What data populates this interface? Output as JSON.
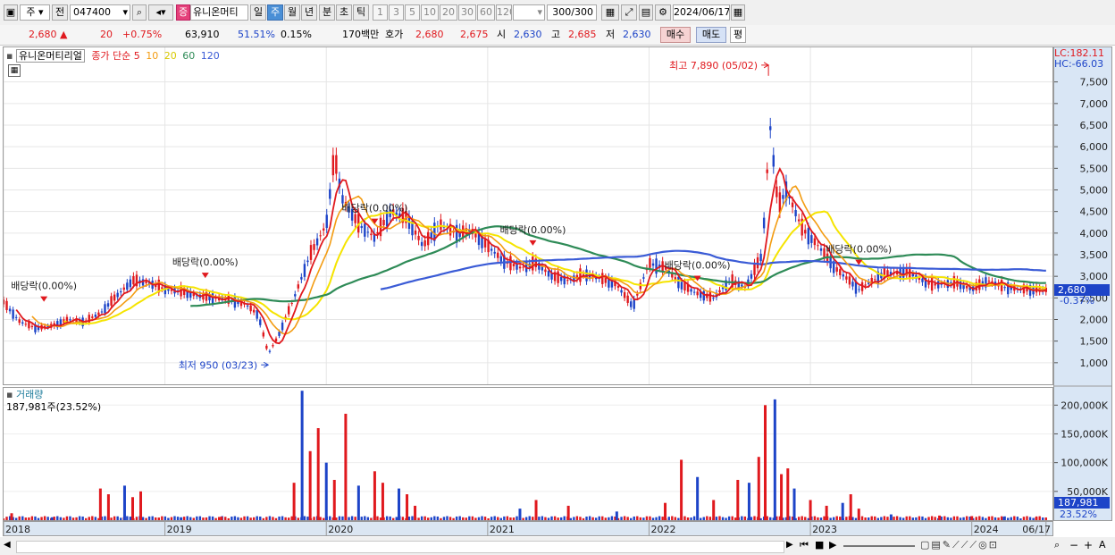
{
  "toolbar": {
    "period_btn": "주",
    "prev_btn": "전",
    "code_value": "047400",
    "stock_name": "유니온머티",
    "badge": "증",
    "periods": [
      "일",
      "주",
      "월",
      "년",
      "분",
      "초",
      "틱"
    ],
    "intervals": [
      "1",
      "3",
      "5",
      "10",
      "20",
      "30",
      "60",
      "120"
    ],
    "count_value": "300",
    "count_total": "/300",
    "date_value": "2024/06/17"
  },
  "info": {
    "price": "2,680",
    "change": "20",
    "change_pct": "+0.75%",
    "volume": "63,910",
    "vol_ratio": "51.51%",
    "turnover": "0.15%",
    "amount": "170백만",
    "quote_label": "호가",
    "ask": "2,680",
    "bid": "2,675",
    "open_label": "시",
    "open": "2,630",
    "high_label": "고",
    "high": "2,685",
    "low_label": "저",
    "low": "2,630",
    "buy_btn": "매수",
    "sell_btn": "매도",
    "eval_btn": "평"
  },
  "price_panel": {
    "stock_label": "유니온머티리얼",
    "ma_label": "종가 단순",
    "ma_periods": [
      "5",
      "10",
      "20",
      "60",
      "120"
    ],
    "lc": "LC:182.11",
    "hc": "HC:-66.03"
  },
  "vol_panel": {
    "title": "거래량",
    "value": "187,981주(23.52%)",
    "axis_value": "187,981",
    "axis_pct": "23.52%"
  },
  "colors": {
    "up": "#e0191e",
    "down": "#1d44c8",
    "ma5": "#e0191e",
    "ma10": "#f39c12",
    "ma20": "#f5e400",
    "ma60": "#2e8b57",
    "ma120": "#3a5bd6"
  },
  "chart_data": {
    "type": "candlestick",
    "y_ticks": [
      1000,
      1500,
      2000,
      2500,
      3000,
      3500,
      4000,
      4500,
      5000,
      5500,
      6000,
      6500,
      7000,
      7500
    ],
    "y_tick_labels": [
      "1,000",
      "1,500",
      "2,000",
      "2,500",
      "3,000",
      "3,500",
      "4,000",
      "4,500",
      "5,000",
      "5,500",
      "6,000",
      "6,500",
      "7,000",
      "7,500"
    ],
    "ylim": [
      500,
      8300
    ],
    "current_price": 2680,
    "current_label": "2,680",
    "current_pct": "-0.37%",
    "x_labels": [
      "2018",
      "2019",
      "2020",
      "2021",
      "2022",
      "2023",
      "2024",
      "06/17"
    ],
    "x_label_dates": [
      2018.0,
      2019.0,
      2020.0,
      2021.0,
      2022.0,
      2023.0,
      2024.0,
      2024.46
    ],
    "xlim": [
      2018.0,
      2024.5
    ],
    "price_series": [
      [
        2018.0,
        2400
      ],
      [
        2018.1,
        1950
      ],
      [
        2018.2,
        1800
      ],
      [
        2018.3,
        1850
      ],
      [
        2018.4,
        2000
      ],
      [
        2018.5,
        1950
      ],
      [
        2018.6,
        2150
      ],
      [
        2018.7,
        2550
      ],
      [
        2018.8,
        2900
      ],
      [
        2018.9,
        2850
      ],
      [
        2019.0,
        2700
      ],
      [
        2019.1,
        2650
      ],
      [
        2019.2,
        2550
      ],
      [
        2019.3,
        2500
      ],
      [
        2019.4,
        2450
      ],
      [
        2019.5,
        2350
      ],
      [
        2019.58,
        2100
      ],
      [
        2019.64,
        1200
      ],
      [
        2019.7,
        1600
      ],
      [
        2019.8,
        2500
      ],
      [
        2019.9,
        3500
      ],
      [
        2020.0,
        4200
      ],
      [
        2020.05,
        5800
      ],
      [
        2020.1,
        4800
      ],
      [
        2020.2,
        4200
      ],
      [
        2020.3,
        3900
      ],
      [
        2020.4,
        4500
      ],
      [
        2020.5,
        4350
      ],
      [
        2020.6,
        3700
      ],
      [
        2020.7,
        4200
      ],
      [
        2020.8,
        4000
      ],
      [
        2020.9,
        4050
      ],
      [
        2021.0,
        3700
      ],
      [
        2021.1,
        3350
      ],
      [
        2021.2,
        3200
      ],
      [
        2021.3,
        3300
      ],
      [
        2021.4,
        3000
      ],
      [
        2021.5,
        2900
      ],
      [
        2021.6,
        3050
      ],
      [
        2021.7,
        2950
      ],
      [
        2021.8,
        2800
      ],
      [
        2021.9,
        2300
      ],
      [
        2022.0,
        3300
      ],
      [
        2022.1,
        3200
      ],
      [
        2022.2,
        2800
      ],
      [
        2022.3,
        2600
      ],
      [
        2022.4,
        2500
      ],
      [
        2022.5,
        2900
      ],
      [
        2022.6,
        2750
      ],
      [
        2022.7,
        3500
      ],
      [
        2022.75,
        6500
      ],
      [
        2022.8,
        4600
      ],
      [
        2022.85,
        5000
      ],
      [
        2022.95,
        4100
      ],
      [
        2023.05,
        3700
      ],
      [
        2023.15,
        3200
      ],
      [
        2023.3,
        2700
      ],
      [
        2023.45,
        3050
      ],
      [
        2023.6,
        3100
      ],
      [
        2023.75,
        2800
      ],
      [
        2023.9,
        2850
      ],
      [
        2024.0,
        2700
      ],
      [
        2024.1,
        2900
      ],
      [
        2024.2,
        2750
      ],
      [
        2024.3,
        2700
      ],
      [
        2024.4,
        2680
      ]
    ],
    "annotations": [
      {
        "text": "최고 7,890 (05/02)",
        "x": 2022.74,
        "y": 7890,
        "color": "#e0191e"
      },
      {
        "text": "최저 950 (03/23)",
        "x": 2019.64,
        "y": 950,
        "color": "#1d44c8"
      },
      {
        "text": "배당락(0.00%)",
        "x": 2018.25,
        "y": 2700
      },
      {
        "text": "배당락(0.00%)",
        "x": 2019.25,
        "y": 3250
      },
      {
        "text": "배당락(0.00%)",
        "x": 2020.3,
        "y": 4500
      },
      {
        "text": "배당락(0.00%)",
        "x": 2021.28,
        "y": 4000
      },
      {
        "text": "배당락(0.00%)",
        "x": 2022.3,
        "y": 3180
      },
      {
        "text": "배당락(0.00%)",
        "x": 2023.3,
        "y": 3550
      }
    ],
    "volume": {
      "y_ticks": [
        50000,
        100000,
        150000,
        200000
      ],
      "y_tick_labels": [
        "50,000K",
        "100,000K",
        "150,000K",
        "200,000K"
      ],
      "ylim": [
        0,
        230000
      ],
      "spikes": [
        [
          2018.05,
          12000
        ],
        [
          2018.3,
          5000
        ],
        [
          2018.6,
          55000
        ],
        [
          2018.65,
          45000
        ],
        [
          2018.75,
          60000
        ],
        [
          2018.8,
          40000
        ],
        [
          2018.85,
          50000
        ],
        [
          2019.1,
          5000
        ],
        [
          2019.35,
          6000
        ],
        [
          2019.8,
          65000
        ],
        [
          2019.85,
          225000
        ],
        [
          2019.9,
          120000
        ],
        [
          2019.95,
          160000
        ],
        [
          2020.0,
          100000
        ],
        [
          2020.05,
          70000
        ],
        [
          2020.12,
          185000
        ],
        [
          2020.2,
          60000
        ],
        [
          2020.3,
          85000
        ],
        [
          2020.35,
          65000
        ],
        [
          2020.45,
          55000
        ],
        [
          2020.5,
          45000
        ],
        [
          2020.55,
          25000
        ],
        [
          2021.2,
          20000
        ],
        [
          2021.3,
          35000
        ],
        [
          2021.5,
          25000
        ],
        [
          2021.8,
          15000
        ],
        [
          2022.1,
          30000
        ],
        [
          2022.2,
          105000
        ],
        [
          2022.3,
          75000
        ],
        [
          2022.4,
          35000
        ],
        [
          2022.55,
          70000
        ],
        [
          2022.62,
          65000
        ],
        [
          2022.68,
          110000
        ],
        [
          2022.72,
          200000
        ],
        [
          2022.78,
          210000
        ],
        [
          2022.82,
          80000
        ],
        [
          2022.86,
          90000
        ],
        [
          2022.9,
          55000
        ],
        [
          2023.0,
          35000
        ],
        [
          2023.1,
          25000
        ],
        [
          2023.2,
          30000
        ],
        [
          2023.25,
          45000
        ],
        [
          2023.3,
          20000
        ],
        [
          2023.5,
          10000
        ],
        [
          2023.8,
          8000
        ],
        [
          2024.0,
          7000
        ],
        [
          2024.2,
          6000
        ],
        [
          2024.4,
          5000
        ]
      ]
    }
  }
}
